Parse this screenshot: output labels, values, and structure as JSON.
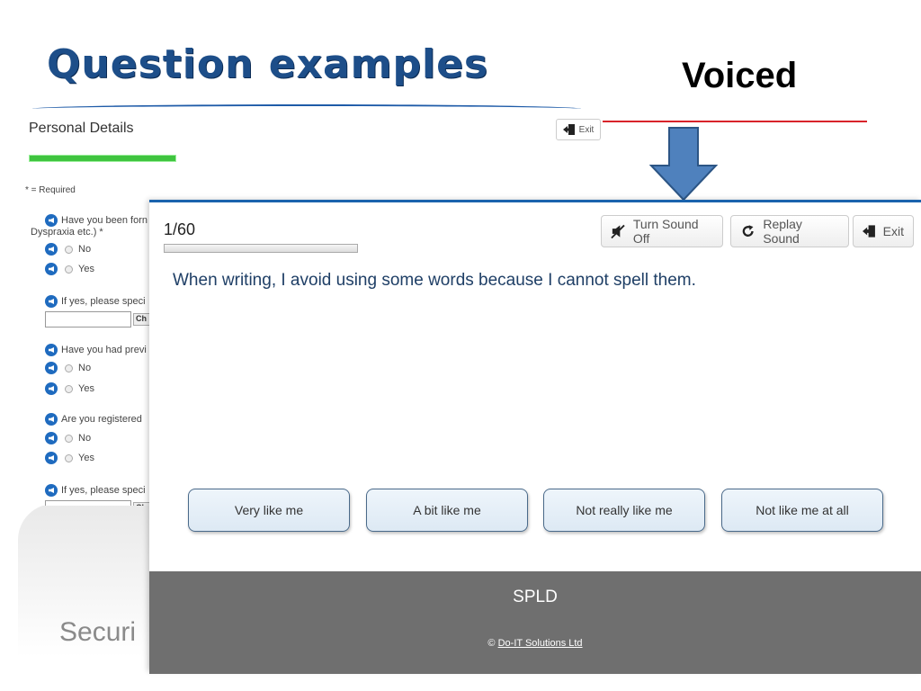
{
  "slide": {
    "title": "Question examples",
    "subtitle": "Voiced",
    "colors": {
      "title": "#1d4e89",
      "red_line": "#d8232a",
      "arrow": "#4f81bd"
    }
  },
  "background_form": {
    "title": "Personal Details",
    "exit_label": "Exit",
    "required_note": "* = Required",
    "q1_line1": "Have you been forn",
    "q1_line2": "Dyspraxia etc.) *",
    "q1_opt1": "No",
    "q1_opt2": "Yes",
    "q2": "If yes, please speci",
    "q2_btn": "Ch",
    "q3": "Have you had previ",
    "q3_opt1": "No",
    "q3_opt2": "Yes",
    "q4": "Are you registered",
    "q4_opt1": "No",
    "q4_opt2": "Yes",
    "q5": "If yes, please speci",
    "q5_btn": "Ch",
    "faded_text": "Securi"
  },
  "app": {
    "counter": "1/60",
    "buttons": {
      "sound_off": "Turn Sound Off",
      "replay": "Replay Sound",
      "exit": "Exit"
    },
    "question": "When writing, I avoid using some words because I cannot spell them.",
    "answers": [
      "Very like me",
      "A bit like me",
      "Not really like me",
      "Not like me at all"
    ],
    "footer": {
      "brand": "SPLD",
      "copyright_symbol": "©",
      "company_link": "Do-IT Solutions Ltd"
    },
    "colors": {
      "top_border": "#1a63ad",
      "footer_bg": "#6f6f6f",
      "question_text": "#1f3f66"
    }
  }
}
